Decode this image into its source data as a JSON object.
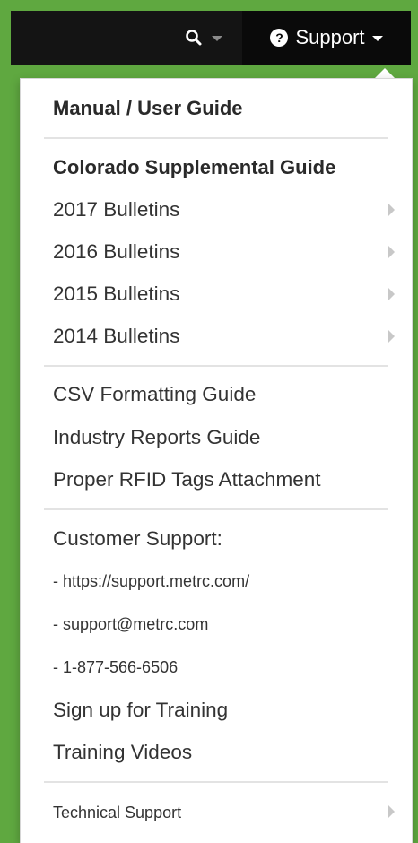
{
  "navbar": {
    "support_label": "Support"
  },
  "menu": {
    "manual": "Manual / User Guide",
    "colorado": "Colorado Supplemental Guide",
    "bulletins": [
      "2017 Bulletins",
      "2016 Bulletins",
      "2015 Bulletins",
      "2014 Bulletins"
    ],
    "guides": [
      "CSV Formatting Guide",
      "Industry Reports Guide",
      "Proper RFID Tags Attachment"
    ],
    "customer_support": "Customer Support:",
    "contact": [
      "- https://support.metrc.com/",
      "- support@metrc.com",
      "- 1-877-566-6506"
    ],
    "training": [
      "Sign up for Training",
      "Training Videos"
    ],
    "technical_support": "Technical Support"
  },
  "colors": {
    "navbar": "#141414",
    "accent_green": "#5fa840",
    "menu_text": "#333333"
  },
  "icons": [
    "search-icon",
    "question-circle-icon",
    "caret-down-icon",
    "chevron-right-icon"
  ]
}
